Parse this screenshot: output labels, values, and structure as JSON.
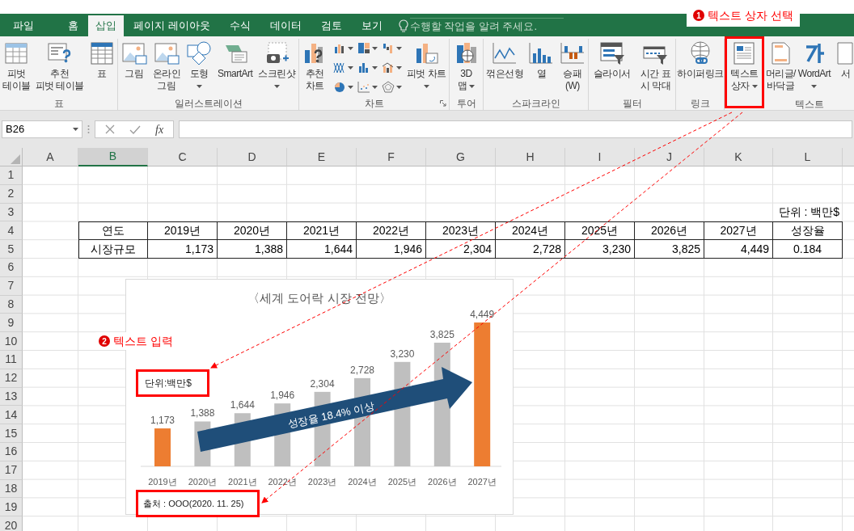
{
  "tabs": [
    {
      "label": "파일",
      "selected": false
    },
    {
      "label": "홈",
      "selected": false
    },
    {
      "label": "삽입",
      "selected": true
    },
    {
      "label": "페이지 레이아웃",
      "selected": false
    },
    {
      "label": "수식",
      "selected": false
    },
    {
      "label": "데이터",
      "selected": false
    },
    {
      "label": "검토",
      "selected": false
    },
    {
      "label": "보기",
      "selected": false
    }
  ],
  "tell_me": {
    "placeholder": "수행할 작업을 알려 주세요."
  },
  "ribbon": {
    "groups": [
      {
        "label": "표",
        "launcher": false,
        "items": [
          {
            "kind": "large",
            "lines": [
              "피벗",
              "테이블"
            ],
            "dropdown": false,
            "framed": false
          },
          {
            "kind": "large",
            "lines": [
              "추천",
              "피벗 테이블"
            ],
            "dropdown": false,
            "framed": false
          },
          {
            "kind": "large",
            "lines": [
              "표"
            ],
            "dropdown": false,
            "framed": false
          }
        ]
      },
      {
        "label": "일러스트레이션",
        "launcher": false,
        "items": [
          {
            "kind": "large",
            "lines": [
              "그림"
            ],
            "dropdown": false,
            "framed": false
          },
          {
            "kind": "large",
            "lines": [
              "온라인",
              "그림"
            ],
            "dropdown": false,
            "framed": false
          },
          {
            "kind": "large",
            "lines": [
              "도형"
            ],
            "dropdown": true,
            "framed": false
          },
          {
            "kind": "large",
            "lines": [
              "SmartArt"
            ],
            "dropdown": false,
            "framed": false
          },
          {
            "kind": "large",
            "lines": [
              "스크린샷"
            ],
            "dropdown": true,
            "framed": false
          }
        ]
      },
      {
        "label": "차트",
        "launcher": true,
        "items": [
          {
            "kind": "large",
            "lines": [
              "추천",
              "차트"
            ],
            "dropdown": false,
            "framed": false
          },
          {
            "kind": "mini-grid"
          },
          {
            "kind": "large",
            "lines": [
              "피벗 차트"
            ],
            "dropdown": true,
            "framed": false
          }
        ]
      },
      {
        "label": "투어",
        "launcher": false,
        "items": [
          {
            "kind": "large",
            "lines": [
              "3D",
              "맵"
            ],
            "dropdown": true,
            "framed": false
          }
        ]
      },
      {
        "label": "스파크라인",
        "launcher": false,
        "items": [
          {
            "kind": "large",
            "lines": [
              "꺾은선형"
            ],
            "dropdown": false,
            "framed": false
          },
          {
            "kind": "large",
            "lines": [
              "열"
            ],
            "dropdown": false,
            "framed": false
          },
          {
            "kind": "large",
            "lines": [
              "승패",
              "(W)"
            ],
            "dropdown": false,
            "framed": false
          }
        ]
      },
      {
        "label": "필터",
        "launcher": false,
        "items": [
          {
            "kind": "large",
            "lines": [
              "슬라이서"
            ],
            "dropdown": false,
            "framed": false
          },
          {
            "kind": "large",
            "lines": [
              "시간 표",
              "시 막대"
            ],
            "dropdown": false,
            "framed": false
          }
        ]
      },
      {
        "label": "링크",
        "launcher": false,
        "items": [
          {
            "kind": "large",
            "lines": [
              "하이퍼링크"
            ],
            "dropdown": false,
            "framed": false
          }
        ]
      },
      {
        "label": "텍스트",
        "launcher": false,
        "items": [
          {
            "kind": "large",
            "lines": [
              "텍스트",
              "상자"
            ],
            "dropdown": true,
            "framed": true
          },
          {
            "kind": "large",
            "lines": [
              "머리글/",
              "바닥글"
            ],
            "dropdown": false,
            "framed": false
          },
          {
            "kind": "large",
            "lines": [
              "WordArt"
            ],
            "dropdown": true,
            "framed": false
          },
          {
            "kind": "large",
            "lines": [
              "서"
            ],
            "dropdown": false,
            "framed": false
          }
        ]
      }
    ]
  },
  "formula_bar": {
    "name_box": "B26",
    "function_label": "fx"
  },
  "sheet": {
    "columns": [
      {
        "label": "A",
        "selected": false
      },
      {
        "label": "B",
        "selected": true
      },
      {
        "label": "C",
        "selected": false
      },
      {
        "label": "D",
        "selected": false
      },
      {
        "label": "E",
        "selected": false
      },
      {
        "label": "F",
        "selected": false
      },
      {
        "label": "G",
        "selected": false
      },
      {
        "label": "H",
        "selected": false
      },
      {
        "label": "I",
        "selected": false
      },
      {
        "label": "J",
        "selected": false
      },
      {
        "label": "K",
        "selected": false
      },
      {
        "label": "L",
        "selected": false
      }
    ],
    "rows": [
      "1",
      "2",
      "3",
      "4",
      "5",
      "6",
      "7",
      "8",
      "9",
      "10",
      "11",
      "12",
      "13",
      "14",
      "15",
      "16",
      "17",
      "18",
      "19",
      "20"
    ],
    "unit_note": "단위 : 백만$",
    "data_table": {
      "header": [
        "연도",
        "2019년",
        "2020년",
        "2021년",
        "2022년",
        "2023년",
        "2024년",
        "2025년",
        "2026년",
        "2027년",
        "성장율"
      ],
      "values": [
        "시장규모",
        "1,173",
        "1,388",
        "1,644",
        "1,946",
        "2,304",
        "2,728",
        "3,230",
        "3,825",
        "4,449",
        "0.184"
      ]
    }
  },
  "chart": {
    "chart_data": {
      "type": "bar",
      "title": "〈세계 도어락 시장 전망〉",
      "categories": [
        "2019년",
        "2020년",
        "2021년",
        "2022년",
        "2023년",
        "2024년",
        "2025년",
        "2026년",
        "2027년"
      ],
      "stacked": true,
      "data_labels": true,
      "series": [
        {
          "color": "#ed7d31",
          "values": [
            1173,
            null,
            null,
            null,
            null,
            null,
            null,
            null,
            4449
          ],
          "value_labels": [
            "1,173",
            null,
            null,
            null,
            null,
            null,
            null,
            null,
            "4,449"
          ]
        },
        {
          "color": "#bfbfbf",
          "values": [
            null,
            1388,
            1644,
            1946,
            2304,
            2728,
            3230,
            3825,
            null
          ],
          "value_labels": [
            null,
            "1,388",
            "1,644",
            "1,946",
            "2,304",
            "2,728",
            "3,230",
            "3,825",
            null
          ]
        }
      ]
    },
    "text_boxes": [
      "단위:백만$",
      "출처 : OOO(2020. 11. 25)"
    ],
    "arrow_label": "성장율 18.4% 이상"
  },
  "annotations": [
    {
      "marker": "1",
      "text": "텍스트 상자 선택"
    },
    {
      "marker": "2",
      "text": "텍스트 입력"
    }
  ]
}
